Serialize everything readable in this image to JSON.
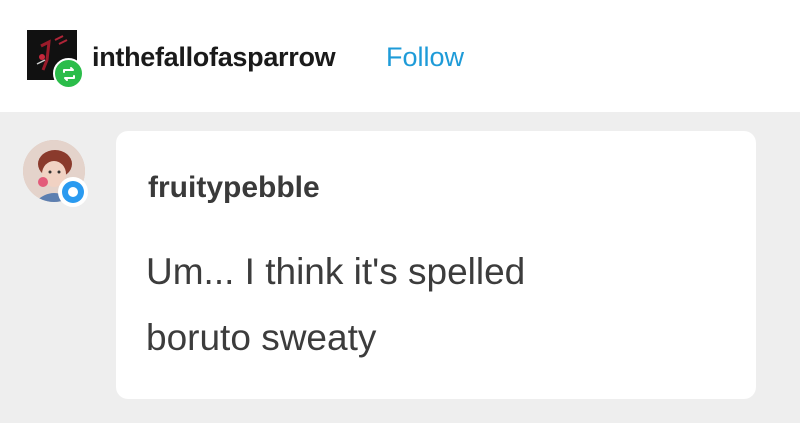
{
  "header": {
    "username": "inthefallofasparrow",
    "follow_label": "Follow",
    "avatar_icon": "blog-avatar-icon",
    "reblog_icon": "reblog-icon"
  },
  "comment": {
    "author": "fruitypebble",
    "lines": [
      "Um... I think it's spelled",
      "boruto sweaty"
    ],
    "avatar_icon": "commenter-avatar-icon",
    "badge_icon": "online-badge-icon"
  },
  "colors": {
    "follow": "#1e9bd8",
    "reblog_badge": "#2bbd4a",
    "commenter_badge": "#2a9af0",
    "comment_area_bg": "#eeeeee"
  }
}
